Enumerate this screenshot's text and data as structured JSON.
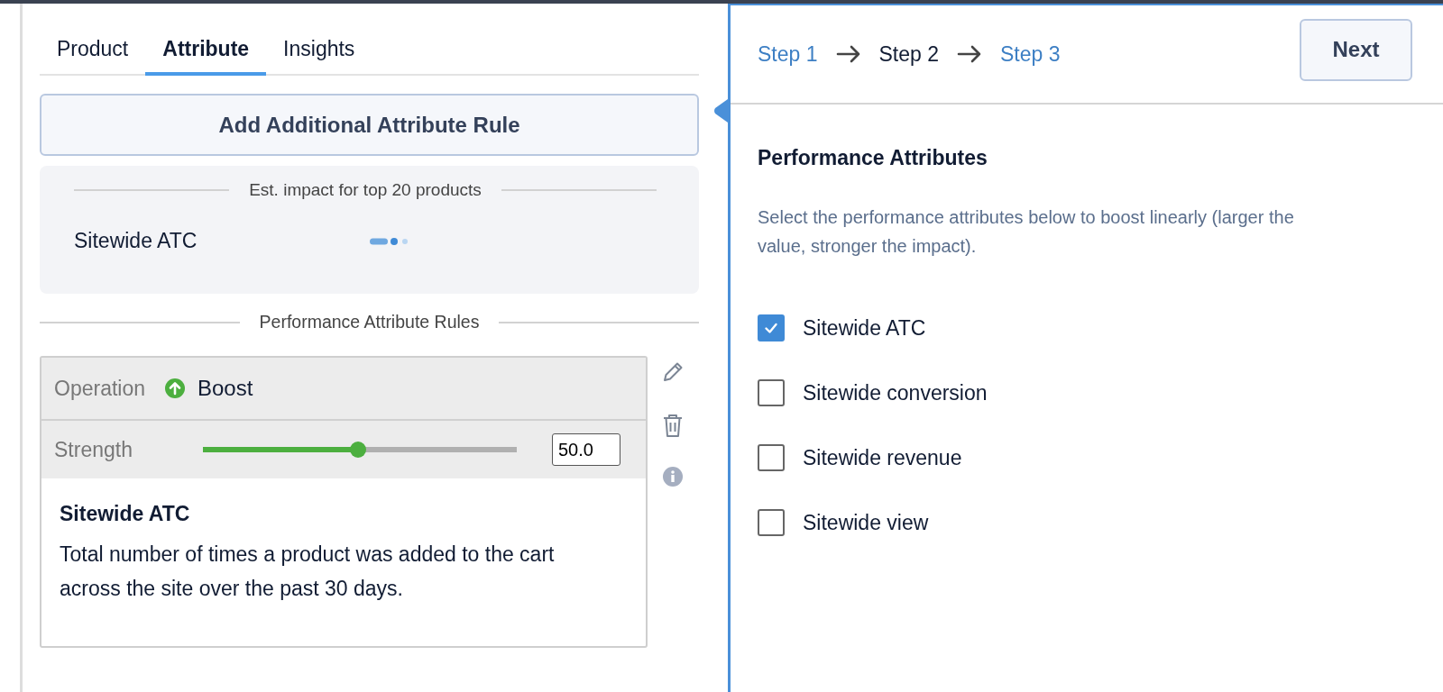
{
  "tabs": [
    {
      "label": "Product",
      "selected": false
    },
    {
      "label": "Attribute",
      "selected": true
    },
    {
      "label": "Insights",
      "selected": false
    }
  ],
  "add_rule_button": "Add Additional Attribute Rule",
  "impact": {
    "title": "Est. impact for top 20 products",
    "rows": [
      {
        "name": "Sitewide ATC"
      }
    ]
  },
  "rules_heading": "Performance Attribute Rules",
  "rule": {
    "operation_label": "Operation",
    "operation": "Boost",
    "strength_label": "Strength",
    "level": 0.47,
    "strength_value": "50.0",
    "title": "Sitewide ATC",
    "description": "Total number of times a product was added to the cart across the site over the past 30 days."
  },
  "steps": [
    {
      "label": "Step 1",
      "selected": false
    },
    {
      "label": "Step 2",
      "selected": true
    },
    {
      "label": "Step 3",
      "selected": false
    }
  ],
  "next_button": "Next",
  "section_title": "Performance Attributes",
  "section_description": "Select the performance attributes below to boost linearly (larger the value, stronger the impact).",
  "attributes": [
    {
      "label": "Sitewide ATC",
      "checked": true
    },
    {
      "label": "Sitewide conversion",
      "checked": false
    },
    {
      "label": "Sitewide revenue",
      "checked": false
    },
    {
      "label": "Sitewide view",
      "checked": false
    }
  ]
}
